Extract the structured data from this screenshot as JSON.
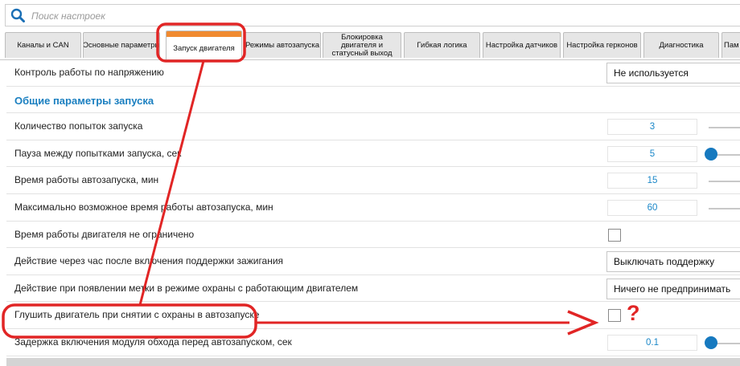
{
  "search": {
    "placeholder": "Поиск настроек"
  },
  "tabs": [
    {
      "label": "Каналы и CAN"
    },
    {
      "label": "Основные параметры"
    },
    {
      "label": "Запуск двигателя"
    },
    {
      "label": "Режимы автозапуска"
    },
    {
      "label": "Блокировка двигателя и статусный выход"
    },
    {
      "label": "Гибкая логика"
    },
    {
      "label": "Настройка датчиков"
    },
    {
      "label": "Настройка герконов"
    },
    {
      "label": "Диагностика"
    },
    {
      "label": "Пам"
    }
  ],
  "rows": [
    {
      "label": "Контроль работы по напряжению",
      "value": "Не используется"
    },
    {
      "label": "Общие параметры запуска"
    },
    {
      "label": "Количество попыток запуска",
      "value": "3"
    },
    {
      "label": "Пауза между попытками запуска, сек",
      "value": "5"
    },
    {
      "label": "Время работы автозапуска, мин",
      "value": "15"
    },
    {
      "label": "Максимально возможное время работы автозапуска, мин",
      "value": "60"
    },
    {
      "label": "Время работы двигателя не ограничено",
      "checked": false
    },
    {
      "label": "Действие через час после включения поддержки зажигания",
      "value": "Выключать поддержку"
    },
    {
      "label": "Действие при появлении метки в режиме охраны с работающим двигателем",
      "value": "Ничего не предпринимать"
    },
    {
      "label": "Глушить двигатель при снятии с охраны в автозапуске",
      "checked": false
    },
    {
      "label": "Задержка включения модуля обхода перед автозапуском, сек",
      "value": "0.1"
    }
  ],
  "annotation": {
    "question_mark": "?"
  },
  "colors": {
    "accent_tab": "#f08a30",
    "section_title": "#1a7fc0",
    "value_text": "#1a87c8",
    "slider_knob": "#1679bf",
    "annotation": "#e12525"
  }
}
